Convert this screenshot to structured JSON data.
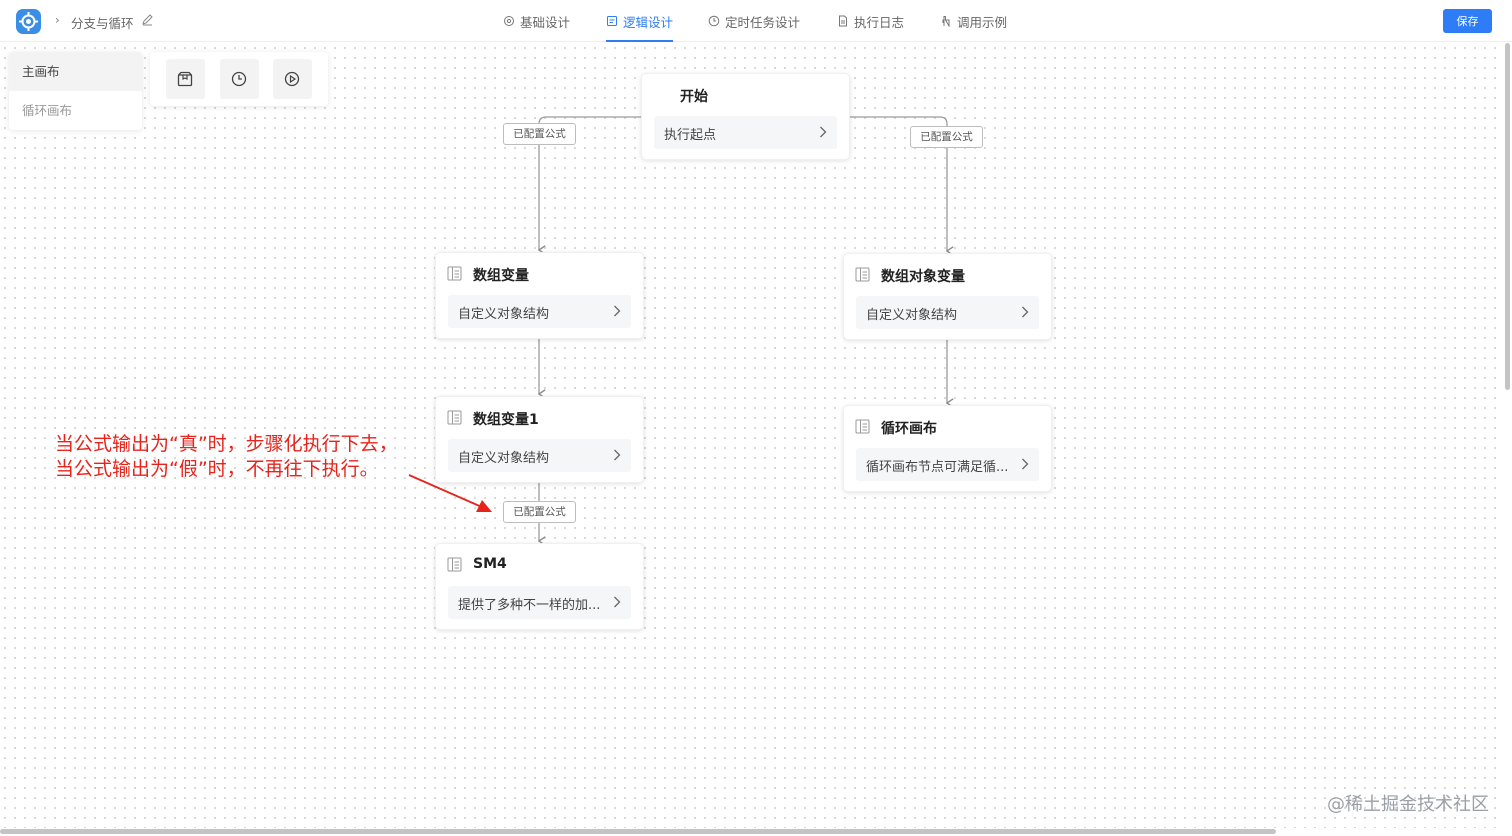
{
  "header": {
    "breadcrumb_title": "分支与循环",
    "tabs": [
      {
        "label": "基础设计",
        "icon": "settings-icon"
      },
      {
        "label": "逻辑设计",
        "icon": "logic-icon",
        "active": true
      },
      {
        "label": "定时任务设计",
        "icon": "clock-icon"
      },
      {
        "label": "执行日志",
        "icon": "document-icon"
      },
      {
        "label": "调用示例",
        "icon": "hand-pointer-icon"
      }
    ],
    "save_label": "保存"
  },
  "canvas_tabs": {
    "main": "主画布",
    "loop": "循环画布"
  },
  "tools": [
    "package-icon",
    "clock-icon",
    "play-icon"
  ],
  "nodes": {
    "start": {
      "title": "开始",
      "desc": "执行起点"
    },
    "array_var": {
      "title": "数组变量",
      "desc": "自定义对象结构"
    },
    "array_obj_var": {
      "title": "数组对象变量",
      "desc": "自定义对象结构"
    },
    "array_var1": {
      "title": "数组变量1",
      "desc": "自定义对象结构"
    },
    "loop_canvas": {
      "title": "循环画布",
      "desc": "循环画布节点可满足循..."
    },
    "sm4": {
      "title": "SM4",
      "desc": "提供了多种不一样的加..."
    }
  },
  "formula_tags": {
    "left": "已配置公式",
    "right": "已配置公式",
    "bottom": "已配置公式"
  },
  "annotation": {
    "line1": "当公式输出为“真”时，步骤化执行下去，",
    "line2": "当公式输出为“假”时，不再往下执行。"
  },
  "watermark": "@稀土掘金技术社区",
  "colors": {
    "primary": "#2f7df6",
    "annotation_red": "#e8231c",
    "logo": "#3a8ee6"
  }
}
